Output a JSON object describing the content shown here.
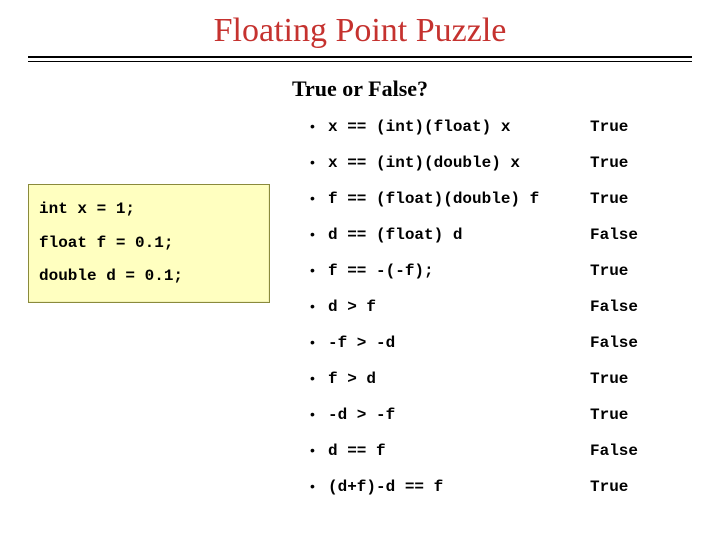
{
  "title": "Floating Point Puzzle",
  "subtitle": "True or False?",
  "declarations": [
    "int x = 1;",
    "float f = 0.1;",
    "double d = 0.1;"
  ],
  "rows": [
    {
      "expr": "x == (int)(float) x",
      "answer": "True"
    },
    {
      "expr": "x == (int)(double) x",
      "answer": "True"
    },
    {
      "expr": "f == (float)(double) f",
      "answer": "True"
    },
    {
      "expr": "d == (float) d",
      "answer": "False"
    },
    {
      "expr": "f == -(-f);",
      "answer": "True"
    },
    {
      "expr": "d > f",
      "answer": "False"
    },
    {
      "expr": "-f > -d",
      "answer": "False"
    },
    {
      "expr": "f > d",
      "answer": "True"
    },
    {
      "expr": "-d > -f",
      "answer": "True"
    },
    {
      "expr": "d == f",
      "answer": "False"
    },
    {
      "expr": "(d+f)-d == f",
      "answer": "True"
    }
  ]
}
